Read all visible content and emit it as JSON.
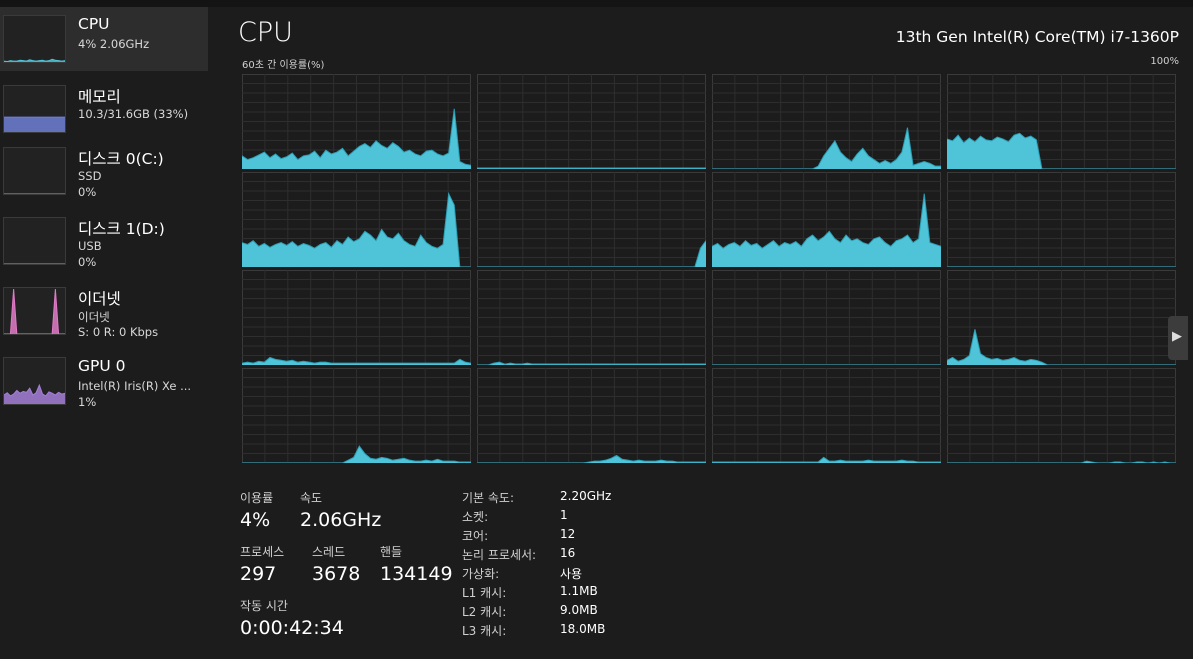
{
  "sidebar": {
    "items": [
      {
        "title": "CPU",
        "line2": "4% 2.06GHz",
        "line3": "",
        "active": true,
        "thumb_color": "#4fc3d7",
        "thumb": [
          2,
          1,
          3,
          2,
          2,
          4,
          3,
          2,
          5,
          3,
          2,
          3,
          4,
          2,
          3,
          6,
          4,
          3,
          2,
          3
        ]
      },
      {
        "title": "메모리",
        "line2": "10.3/31.6GB (33%)",
        "line3": "",
        "active": false,
        "thumb_color": "#6f7fd6",
        "thumb": [
          33,
          33,
          33,
          33,
          33,
          33,
          33,
          33,
          33,
          33,
          33,
          33,
          33,
          33,
          33,
          33,
          33,
          33,
          33,
          33
        ]
      },
      {
        "title": "디스크 0(C:)",
        "line2": "SSD",
        "line3": "0%",
        "active": false,
        "thumb_color": "#6cc36f",
        "thumb": [
          0,
          0,
          0,
          0,
          0,
          0,
          0,
          0,
          0,
          0,
          0,
          0,
          0,
          0,
          0,
          0,
          0,
          0,
          0,
          0
        ]
      },
      {
        "title": "디스크 1(D:)",
        "line2": "USB",
        "line3": "0%",
        "active": false,
        "thumb_color": "#6cc36f",
        "thumb": [
          0,
          0,
          0,
          0,
          0,
          0,
          0,
          0,
          0,
          0,
          0,
          0,
          0,
          0,
          0,
          0,
          0,
          0,
          0,
          0
        ]
      },
      {
        "title": "이더넷",
        "line2": "이더넷",
        "line3": "S: 0 R: 0 Kbps",
        "active": false,
        "thumb_color": "#e07bc7",
        "thumb": [
          0,
          0,
          0,
          100,
          0,
          0,
          0,
          0,
          0,
          0,
          0,
          0,
          0,
          0,
          0,
          0,
          100,
          0,
          0,
          0
        ]
      },
      {
        "title": "GPU 0",
        "line2": "Intel(R) Iris(R) Xe ...",
        "line3": "1%",
        "active": false,
        "thumb_color": "#a47fd6",
        "thumb": [
          20,
          25,
          18,
          22,
          30,
          24,
          28,
          26,
          35,
          20,
          25,
          42,
          22,
          18,
          27,
          24,
          20,
          26,
          22,
          24
        ]
      }
    ]
  },
  "header": {
    "title": "CPU",
    "cpu_model": "13th Gen Intel(R) Core(TM) i7-1360P",
    "graph_caption": "60초 간 이용률(%)",
    "graph_max": "100%"
  },
  "colors": {
    "fill": "#4fc3d7",
    "line": "#2b9fb5",
    "grid": "#3a3a3a"
  },
  "cores": [
    {
      "values": [
        14,
        10,
        12,
        15,
        18,
        12,
        16,
        11,
        13,
        17,
        10,
        14,
        15,
        19,
        12,
        20,
        16,
        18,
        22,
        14,
        19,
        24,
        27,
        23,
        30,
        25,
        22,
        28,
        24,
        18,
        20,
        16,
        14,
        19,
        20,
        16,
        14,
        17,
        64,
        8,
        5,
        4
      ]
    },
    {
      "values": [
        1,
        1,
        1,
        1,
        1,
        1,
        1,
        1,
        1,
        1,
        1,
        1,
        1,
        1,
        1,
        1,
        1,
        1,
        1,
        1,
        1,
        1,
        1,
        1,
        1,
        1,
        1,
        1,
        1,
        1,
        1,
        1,
        1,
        1,
        1,
        1,
        1,
        1,
        1,
        1,
        1,
        1
      ]
    },
    {
      "values": [
        0,
        0,
        0,
        0,
        0,
        0,
        0,
        0,
        0,
        0,
        0,
        0,
        0,
        0,
        0,
        0,
        0,
        0,
        0,
        3,
        14,
        22,
        30,
        18,
        12,
        8,
        16,
        22,
        14,
        10,
        6,
        9,
        6,
        10,
        18,
        44,
        4,
        6,
        8,
        6,
        3,
        3
      ]
    },
    {
      "values": [
        32,
        30,
        36,
        28,
        33,
        29,
        35,
        31,
        30,
        34,
        32,
        29,
        36,
        38,
        33,
        35,
        31,
        0,
        0,
        0,
        0,
        0,
        0,
        0,
        0,
        0,
        0,
        0,
        0,
        0,
        0,
        0,
        0,
        0,
        0,
        0,
        0,
        0,
        0,
        0,
        0,
        0
      ]
    },
    {
      "values": [
        26,
        24,
        28,
        22,
        25,
        21,
        24,
        26,
        23,
        27,
        22,
        25,
        23,
        20,
        24,
        26,
        21,
        28,
        24,
        32,
        27,
        30,
        38,
        34,
        28,
        40,
        32,
        30,
        36,
        28,
        24,
        22,
        34,
        26,
        22,
        20,
        24,
        78,
        66,
        0,
        0,
        0
      ]
    },
    {
      "values": [
        0,
        0,
        0,
        0,
        0,
        0,
        0,
        0,
        0,
        0,
        0,
        0,
        0,
        0,
        0,
        0,
        0,
        0,
        0,
        0,
        0,
        0,
        0,
        0,
        0,
        0,
        0,
        0,
        0,
        0,
        0,
        0,
        0,
        0,
        0,
        0,
        0,
        0,
        0,
        0,
        20,
        28
      ]
    },
    {
      "values": [
        22,
        25,
        20,
        24,
        26,
        22,
        28,
        23,
        25,
        20,
        24,
        28,
        22,
        26,
        24,
        27,
        22,
        30,
        34,
        28,
        32,
        38,
        30,
        26,
        34,
        28,
        30,
        26,
        24,
        30,
        32,
        26,
        22,
        28,
        30,
        34,
        26,
        30,
        78,
        26,
        24,
        22
      ]
    },
    {
      "values": [
        0,
        0,
        0,
        0,
        0,
        0,
        0,
        0,
        0,
        0,
        0,
        0,
        0,
        0,
        0,
        0,
        0,
        0,
        0,
        0,
        0,
        0,
        0,
        0,
        0,
        0,
        0,
        0,
        0,
        0,
        0,
        0,
        0,
        0,
        0,
        0,
        0,
        0,
        0,
        0,
        0,
        0
      ]
    },
    {
      "values": [
        2,
        3,
        2,
        4,
        3,
        8,
        6,
        5,
        4,
        5,
        3,
        4,
        3,
        2,
        3,
        3,
        2,
        2,
        2,
        2,
        2,
        2,
        2,
        2,
        2,
        2,
        2,
        2,
        2,
        2,
        2,
        2,
        2,
        2,
        2,
        2,
        2,
        2,
        2,
        6,
        3,
        2
      ]
    },
    {
      "values": [
        0,
        0,
        0,
        2,
        3,
        1,
        2,
        1,
        1,
        2,
        1,
        1,
        1,
        1,
        1,
        1,
        1,
        1,
        1,
        1,
        1,
        1,
        1,
        1,
        1,
        1,
        1,
        1,
        1,
        1,
        1,
        1,
        1,
        1,
        1,
        1,
        1,
        1,
        1,
        1,
        1,
        1
      ]
    },
    {
      "values": [
        0,
        0,
        0,
        0,
        0,
        0,
        0,
        0,
        0,
        0,
        0,
        0,
        0,
        0,
        0,
        0,
        0,
        0,
        0,
        0,
        0,
        0,
        0,
        0,
        0,
        0,
        0,
        0,
        0,
        0,
        0,
        0,
        0,
        0,
        0,
        0,
        0,
        0,
        0,
        0,
        0,
        0
      ]
    },
    {
      "values": [
        5,
        8,
        4,
        6,
        10,
        38,
        12,
        8,
        6,
        7,
        5,
        6,
        8,
        5,
        4,
        6,
        5,
        3,
        0,
        0,
        0,
        0,
        0,
        0,
        0,
        0,
        0,
        0,
        0,
        0,
        0,
        0,
        0,
        0,
        0,
        0,
        0,
        0,
        0,
        0,
        0,
        0
      ]
    },
    {
      "values": [
        0,
        0,
        0,
        0,
        0,
        0,
        0,
        0,
        0,
        0,
        0,
        0,
        0,
        0,
        0,
        0,
        0,
        0,
        0,
        3,
        6,
        18,
        10,
        5,
        4,
        6,
        5,
        3,
        4,
        5,
        3,
        2,
        2,
        3,
        2,
        4,
        2,
        2,
        2,
        1,
        1,
        1
      ]
    },
    {
      "values": [
        0,
        0,
        0,
        0,
        0,
        0,
        0,
        0,
        0,
        0,
        0,
        0,
        0,
        0,
        0,
        0,
        0,
        0,
        0,
        0,
        1,
        2,
        2,
        3,
        5,
        8,
        4,
        3,
        2,
        3,
        2,
        2,
        2,
        3,
        2,
        2,
        1,
        1,
        1,
        1,
        1,
        1
      ]
    },
    {
      "values": [
        1,
        1,
        1,
        1,
        1,
        1,
        1,
        1,
        1,
        1,
        1,
        1,
        1,
        1,
        1,
        1,
        1,
        1,
        1,
        1,
        6,
        2,
        2,
        3,
        2,
        2,
        2,
        2,
        3,
        2,
        2,
        2,
        2,
        2,
        3,
        2,
        2,
        1,
        1,
        1,
        1,
        1
      ]
    },
    {
      "values": [
        0,
        0,
        0,
        0,
        0,
        0,
        0,
        0,
        0,
        0,
        0,
        0,
        0,
        0,
        0,
        0,
        0,
        0,
        0,
        0,
        0,
        0,
        0,
        0,
        0,
        2,
        1,
        0,
        0,
        0,
        1,
        1,
        0,
        0,
        1,
        1,
        0,
        1,
        0,
        1,
        0,
        0
      ]
    }
  ],
  "stats": {
    "utilization_label": "이용률",
    "utilization_value": "4%",
    "speed_label": "속도",
    "speed_value": "2.06GHz",
    "processes_label": "프로세스",
    "processes_value": "297",
    "threads_label": "스레드",
    "threads_value": "3678",
    "handles_label": "핸들",
    "handles_value": "134149",
    "uptime_label": "작동 시간",
    "uptime_value": "0:00:42:34"
  },
  "specs": [
    {
      "key": "기본 속도:",
      "value": "2.20GHz"
    },
    {
      "key": "소켓:",
      "value": "1"
    },
    {
      "key": "코어:",
      "value": "12"
    },
    {
      "key": "논리 프로세서:",
      "value": "16"
    },
    {
      "key": "가상화:",
      "value": "사용"
    },
    {
      "key": "L1 캐시:",
      "value": "1.1MB"
    },
    {
      "key": "L2 캐시:",
      "value": "9.0MB"
    },
    {
      "key": "L3 캐시:",
      "value": "18.0MB"
    }
  ],
  "nav": {
    "next_glyph": "▶"
  }
}
